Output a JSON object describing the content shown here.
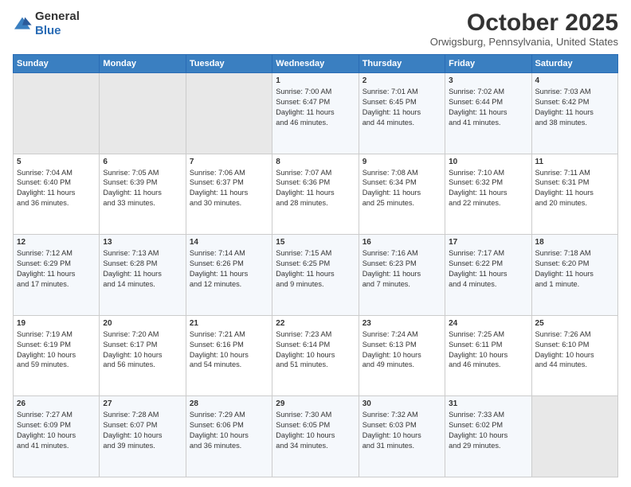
{
  "logo": {
    "text_general": "General",
    "text_blue": "Blue"
  },
  "header": {
    "month": "October 2025",
    "location": "Orwigsburg, Pennsylvania, United States"
  },
  "weekdays": [
    "Sunday",
    "Monday",
    "Tuesday",
    "Wednesday",
    "Thursday",
    "Friday",
    "Saturday"
  ],
  "weeks": [
    [
      {
        "day": "",
        "info": ""
      },
      {
        "day": "",
        "info": ""
      },
      {
        "day": "",
        "info": ""
      },
      {
        "day": "1",
        "info": "Sunrise: 7:00 AM\nSunset: 6:47 PM\nDaylight: 11 hours\nand 46 minutes."
      },
      {
        "day": "2",
        "info": "Sunrise: 7:01 AM\nSunset: 6:45 PM\nDaylight: 11 hours\nand 44 minutes."
      },
      {
        "day": "3",
        "info": "Sunrise: 7:02 AM\nSunset: 6:44 PM\nDaylight: 11 hours\nand 41 minutes."
      },
      {
        "day": "4",
        "info": "Sunrise: 7:03 AM\nSunset: 6:42 PM\nDaylight: 11 hours\nand 38 minutes."
      }
    ],
    [
      {
        "day": "5",
        "info": "Sunrise: 7:04 AM\nSunset: 6:40 PM\nDaylight: 11 hours\nand 36 minutes."
      },
      {
        "day": "6",
        "info": "Sunrise: 7:05 AM\nSunset: 6:39 PM\nDaylight: 11 hours\nand 33 minutes."
      },
      {
        "day": "7",
        "info": "Sunrise: 7:06 AM\nSunset: 6:37 PM\nDaylight: 11 hours\nand 30 minutes."
      },
      {
        "day": "8",
        "info": "Sunrise: 7:07 AM\nSunset: 6:36 PM\nDaylight: 11 hours\nand 28 minutes."
      },
      {
        "day": "9",
        "info": "Sunrise: 7:08 AM\nSunset: 6:34 PM\nDaylight: 11 hours\nand 25 minutes."
      },
      {
        "day": "10",
        "info": "Sunrise: 7:10 AM\nSunset: 6:32 PM\nDaylight: 11 hours\nand 22 minutes."
      },
      {
        "day": "11",
        "info": "Sunrise: 7:11 AM\nSunset: 6:31 PM\nDaylight: 11 hours\nand 20 minutes."
      }
    ],
    [
      {
        "day": "12",
        "info": "Sunrise: 7:12 AM\nSunset: 6:29 PM\nDaylight: 11 hours\nand 17 minutes."
      },
      {
        "day": "13",
        "info": "Sunrise: 7:13 AM\nSunset: 6:28 PM\nDaylight: 11 hours\nand 14 minutes."
      },
      {
        "day": "14",
        "info": "Sunrise: 7:14 AM\nSunset: 6:26 PM\nDaylight: 11 hours\nand 12 minutes."
      },
      {
        "day": "15",
        "info": "Sunrise: 7:15 AM\nSunset: 6:25 PM\nDaylight: 11 hours\nand 9 minutes."
      },
      {
        "day": "16",
        "info": "Sunrise: 7:16 AM\nSunset: 6:23 PM\nDaylight: 11 hours\nand 7 minutes."
      },
      {
        "day": "17",
        "info": "Sunrise: 7:17 AM\nSunset: 6:22 PM\nDaylight: 11 hours\nand 4 minutes."
      },
      {
        "day": "18",
        "info": "Sunrise: 7:18 AM\nSunset: 6:20 PM\nDaylight: 11 hours\nand 1 minute."
      }
    ],
    [
      {
        "day": "19",
        "info": "Sunrise: 7:19 AM\nSunset: 6:19 PM\nDaylight: 10 hours\nand 59 minutes."
      },
      {
        "day": "20",
        "info": "Sunrise: 7:20 AM\nSunset: 6:17 PM\nDaylight: 10 hours\nand 56 minutes."
      },
      {
        "day": "21",
        "info": "Sunrise: 7:21 AM\nSunset: 6:16 PM\nDaylight: 10 hours\nand 54 minutes."
      },
      {
        "day": "22",
        "info": "Sunrise: 7:23 AM\nSunset: 6:14 PM\nDaylight: 10 hours\nand 51 minutes."
      },
      {
        "day": "23",
        "info": "Sunrise: 7:24 AM\nSunset: 6:13 PM\nDaylight: 10 hours\nand 49 minutes."
      },
      {
        "day": "24",
        "info": "Sunrise: 7:25 AM\nSunset: 6:11 PM\nDaylight: 10 hours\nand 46 minutes."
      },
      {
        "day": "25",
        "info": "Sunrise: 7:26 AM\nSunset: 6:10 PM\nDaylight: 10 hours\nand 44 minutes."
      }
    ],
    [
      {
        "day": "26",
        "info": "Sunrise: 7:27 AM\nSunset: 6:09 PM\nDaylight: 10 hours\nand 41 minutes."
      },
      {
        "day": "27",
        "info": "Sunrise: 7:28 AM\nSunset: 6:07 PM\nDaylight: 10 hours\nand 39 minutes."
      },
      {
        "day": "28",
        "info": "Sunrise: 7:29 AM\nSunset: 6:06 PM\nDaylight: 10 hours\nand 36 minutes."
      },
      {
        "day": "29",
        "info": "Sunrise: 7:30 AM\nSunset: 6:05 PM\nDaylight: 10 hours\nand 34 minutes."
      },
      {
        "day": "30",
        "info": "Sunrise: 7:32 AM\nSunset: 6:03 PM\nDaylight: 10 hours\nand 31 minutes."
      },
      {
        "day": "31",
        "info": "Sunrise: 7:33 AM\nSunset: 6:02 PM\nDaylight: 10 hours\nand 29 minutes."
      },
      {
        "day": "",
        "info": ""
      }
    ]
  ]
}
